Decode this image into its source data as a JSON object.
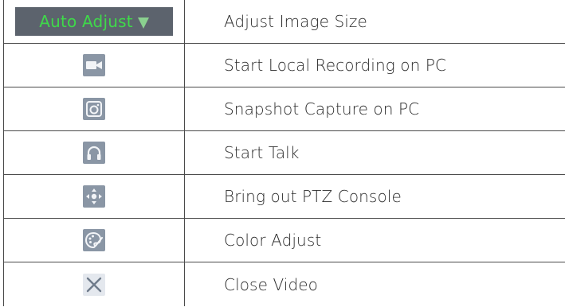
{
  "rows": [
    {
      "control_label": "Auto Adjust",
      "icon": "auto-adjust-dropdown",
      "description": "Adjust Image Size"
    },
    {
      "icon": "video-camera-icon",
      "description": "Start Local Recording on PC"
    },
    {
      "icon": "camera-snapshot-icon",
      "description": "Snapshot Capture on PC"
    },
    {
      "icon": "headphones-icon",
      "description": "Start Talk"
    },
    {
      "icon": "ptz-arrows-icon",
      "description": "Bring out PTZ Console"
    },
    {
      "icon": "color-palette-icon",
      "description": "Color Adjust"
    },
    {
      "icon": "close-x-icon",
      "description": "Close Video"
    }
  ],
  "colors": {
    "dropdown_bg": "#5c636d",
    "dropdown_text": "#3fd94a",
    "icon_tile": "#8a96a5",
    "border": "#4a4a4a"
  }
}
